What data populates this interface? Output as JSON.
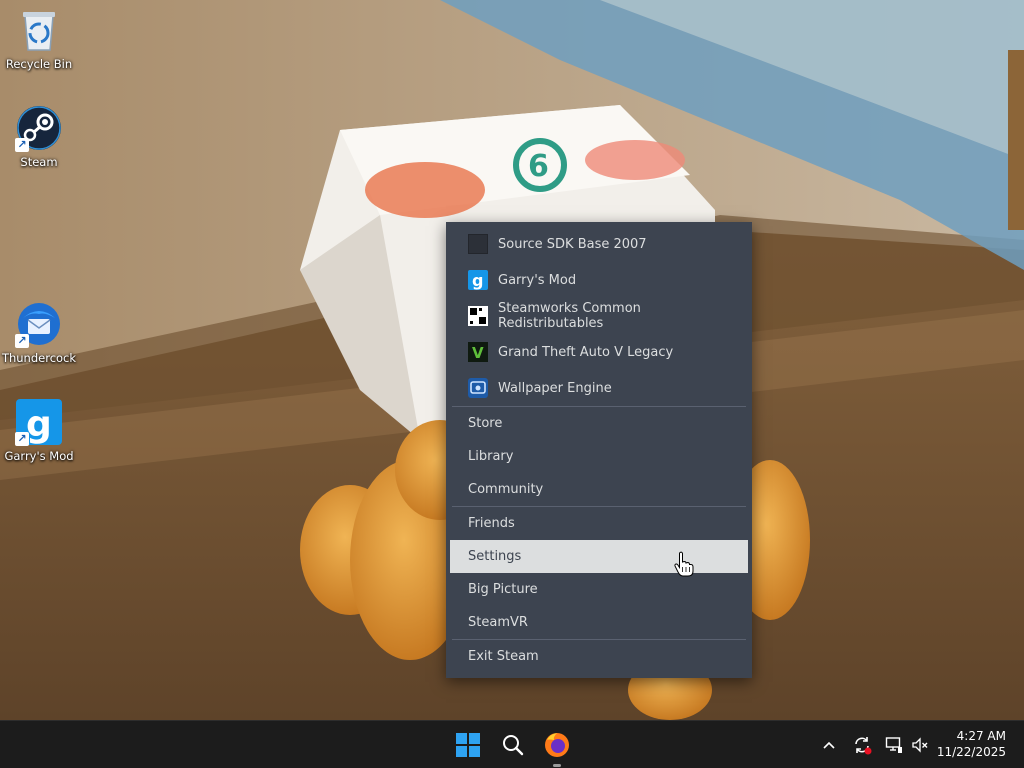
{
  "desktop": {
    "icons": [
      {
        "label": "Recycle Bin"
      },
      {
        "label": "Steam"
      },
      {
        "label": "Thundercock"
      },
      {
        "label": "Garry's Mod"
      }
    ]
  },
  "steam_menu": {
    "games": [
      {
        "label": "Source SDK Base 2007",
        "icon": "source-sdk-icon"
      },
      {
        "label": "Garry's Mod",
        "icon": "garrys-mod-icon"
      },
      {
        "label": "Steamworks Common Redistributables",
        "icon": "steamworks-icon"
      },
      {
        "label": "Grand Theft Auto V Legacy",
        "icon": "gta-v-icon"
      },
      {
        "label": "Wallpaper Engine",
        "icon": "wallpaper-engine-icon"
      }
    ],
    "store": "Store",
    "library": "Library",
    "community": "Community",
    "friends": "Friends",
    "settings": "Settings",
    "big_picture": "Big Picture",
    "steamvr": "SteamVR",
    "exit": "Exit Steam",
    "highlighted": "Settings"
  },
  "taskbar": {
    "time": "4:27 AM",
    "date": "11/22/2025"
  },
  "colors": {
    "menu_bg": "#3d4450",
    "menu_text": "#dcdedf",
    "menu_highlight": "#dcdedf",
    "taskbar_bg": "#1c1c1c"
  }
}
